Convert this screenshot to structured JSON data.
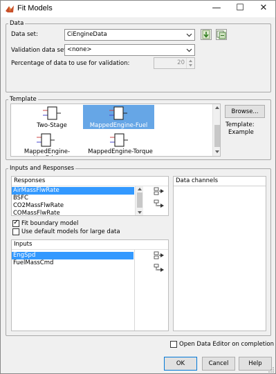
{
  "window": {
    "title": "Fit Models",
    "minimize": "—",
    "maximize": "☐",
    "close": "✕"
  },
  "data_group": {
    "title": "Data",
    "data_set_label": "Data set:",
    "data_set_value": "CiEngineData",
    "validation_label": "Validation data set:",
    "validation_value": "<none>",
    "percentage_label": "Percentage of data to use for validation:",
    "percentage_value": "20"
  },
  "template_group": {
    "title": "Template",
    "items": [
      {
        "label": "Two-Stage",
        "selected": false
      },
      {
        "label": "MappedEngine-Fuel",
        "selected": true
      },
      {
        "label": "MappedEngine-Nonfiring",
        "selected": false
      },
      {
        "label": "MappedEngine-Torque",
        "selected": false
      }
    ],
    "browse_label": "Browse...",
    "template_caption": "Template:",
    "template_name": "Example"
  },
  "io_group": {
    "title": "Inputs and Responses",
    "responses_header": "Responses",
    "responses": [
      "AirMassFlwRate",
      "BSFC",
      "CO2MassFlwRate",
      "COMassFlwRate"
    ],
    "responses_selected": 0,
    "fit_boundary_label": "Fit boundary model",
    "fit_boundary_checked": true,
    "default_models_label": "Use default models for large data",
    "default_models_checked": false,
    "inputs_header": "Inputs",
    "inputs": [
      "EngSpd",
      "FuelMassCmd"
    ],
    "inputs_selected": 0,
    "data_channels_header": "Data channels"
  },
  "footer": {
    "open_editor_label": "Open Data Editor on completion",
    "open_editor_checked": false,
    "ok_label": "OK",
    "cancel_label": "Cancel",
    "help_label": "Help"
  },
  "colors": {
    "selection": "#3399ff",
    "template_selection": "#66a6e6",
    "accent": "#0078d7"
  }
}
